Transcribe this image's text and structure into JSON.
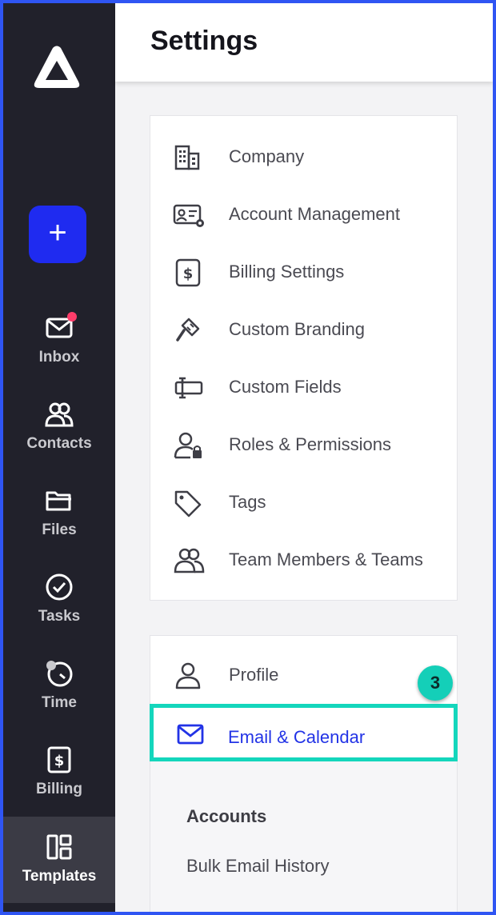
{
  "header": {
    "title": "Settings"
  },
  "rail": {
    "logo": "app-logo",
    "create_label": "+",
    "items": [
      {
        "label": "Inbox",
        "icon": "mail-icon",
        "has_notification": true
      },
      {
        "label": "Contacts",
        "icon": "contacts-icon"
      },
      {
        "label": "Files",
        "icon": "folder-icon"
      },
      {
        "label": "Tasks",
        "icon": "check-circle-icon"
      },
      {
        "label": "Time",
        "icon": "timer-icon"
      },
      {
        "label": "Billing",
        "icon": "billing-icon"
      },
      {
        "label": "Templates",
        "icon": "templates-icon",
        "active": true
      }
    ]
  },
  "settings_firm": [
    {
      "label": "Company",
      "icon": "building-icon"
    },
    {
      "label": "Account Management",
      "icon": "account-card-icon"
    },
    {
      "label": "Billing Settings",
      "icon": "dollar-icon"
    },
    {
      "label": "Custom Branding",
      "icon": "brush-icon"
    },
    {
      "label": "Custom Fields",
      "icon": "text-field-icon"
    },
    {
      "label": "Roles & Permissions",
      "icon": "user-lock-icon"
    },
    {
      "label": "Tags",
      "icon": "tag-icon"
    },
    {
      "label": "Team Members & Teams",
      "icon": "team-icon"
    }
  ],
  "settings_personal": {
    "profile": {
      "label": "Profile",
      "icon": "user-icon"
    },
    "email_calendar": {
      "label": "Email & Calendar",
      "icon": "mail-icon"
    },
    "step_badge": "3",
    "submenu": {
      "heading": "Accounts",
      "items": [
        "Bulk Email History"
      ]
    }
  },
  "colors": {
    "rail_bg": "#21212b",
    "accent": "#1f2bf0",
    "highlight": "#14d6bc",
    "notification": "#ff3d6a"
  }
}
